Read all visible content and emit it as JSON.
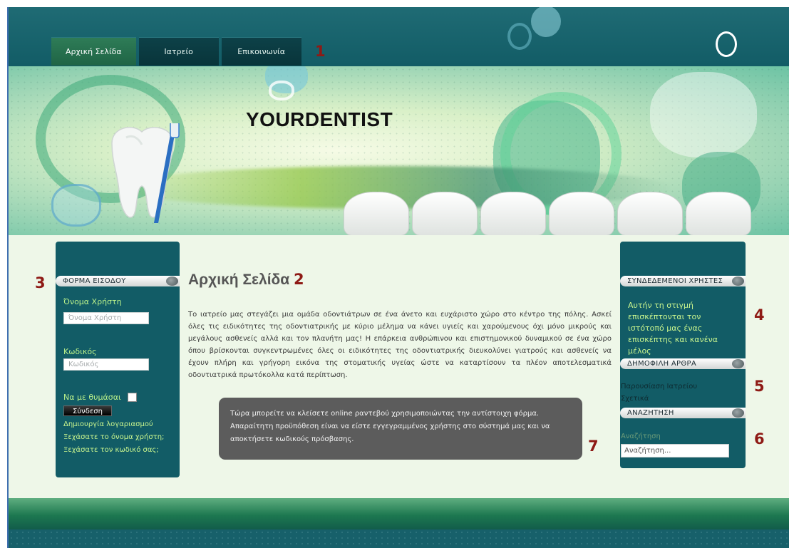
{
  "nav": {
    "items": [
      {
        "label": "Αρχική Σελίδα",
        "active": true
      },
      {
        "label": "Ιατρείο",
        "active": false
      },
      {
        "label": "Επικοινωνία",
        "active": false
      }
    ]
  },
  "banner": {
    "site_title": "YOURDENTIST"
  },
  "markers": [
    "1",
    "2",
    "3",
    "4",
    "5",
    "6",
    "7"
  ],
  "login": {
    "header": "ΦΟΡΜΑ ΕΙΣΟΔΟΥ",
    "username_label": "Όνομα Χρήστη",
    "username_placeholder": "Όνομα Χρήστη",
    "password_label": "Κωδικός",
    "password_placeholder": "Κωδικός",
    "remember_label": "Να με θυμάσαι",
    "submit_label": "Σύνδεση",
    "links": [
      "Δημιουργία λογαριασμού",
      "Ξεχάσατε το όνομα χρήστη;",
      "Ξεχάσατε τον κωδικό σας;"
    ]
  },
  "main": {
    "title": "Αρχική Σελίδα",
    "body": "Το ιατρείο μας στεγάζει μια ομάδα οδοντιάτρων σε ένα άνετο και ευχάριστο χώρο στο κέντρο της πόλης. Ασκεί όλες τις ειδικότητες της οδοντιατρικής με κύριο μέλημα να κάνει υγιείς και χαρούμενους όχι μόνο μικρούς και μεγάλους ασθενείς αλλά και τον πλανήτη μας! Η επάρκεια ανθρώπινου και επιστημονικού δυναμικού σε ένα χώρο όπου βρίσκονται συγκεντρωμένες όλες οι ειδικότητες της οδοντιατρικής διευκολύνει γιατρούς και ασθενείς να έχουν πλήρη και γρήγορη εικόνα της στοματικής υγείας ώστε να καταρτίσουν τα πλέον αποτελεσματικά οδοντιατρικά πρωτόκολλα κατά περίπτωση.",
    "notice": "Τώρα μπορείτε να κλείσετε online ραντεβού χρησιμοποιώντας την αντίστοιχη φόρμα. Απαραίτητη προϋπόθεση είναι να είστε εγγεγραμμένος χρήστης στο σύστημά μας και να αποκτήσετε κωδικούς πρόσβασης."
  },
  "online_users": {
    "header": "ΣΥΝΔΕΔΕΜΕΝΟΙ ΧΡΗΣΤΕΣ",
    "text": "Αυτήν τη στιγμή επισκέπτονται τον ιστότοπό μας ένας επισκέπτης και κανένα μέλος"
  },
  "popular": {
    "header": "ΔΗΜΟΦΙΛΗ ΑΡΘΡΑ",
    "links": [
      "Παρουσίαση Ιατρείου",
      "Σχετικά"
    ]
  },
  "search": {
    "header": "ΑΝΑΖΗΤΗΣΗ",
    "label": "Αναζήτηση",
    "placeholder": "Αναζήτηση..."
  }
}
